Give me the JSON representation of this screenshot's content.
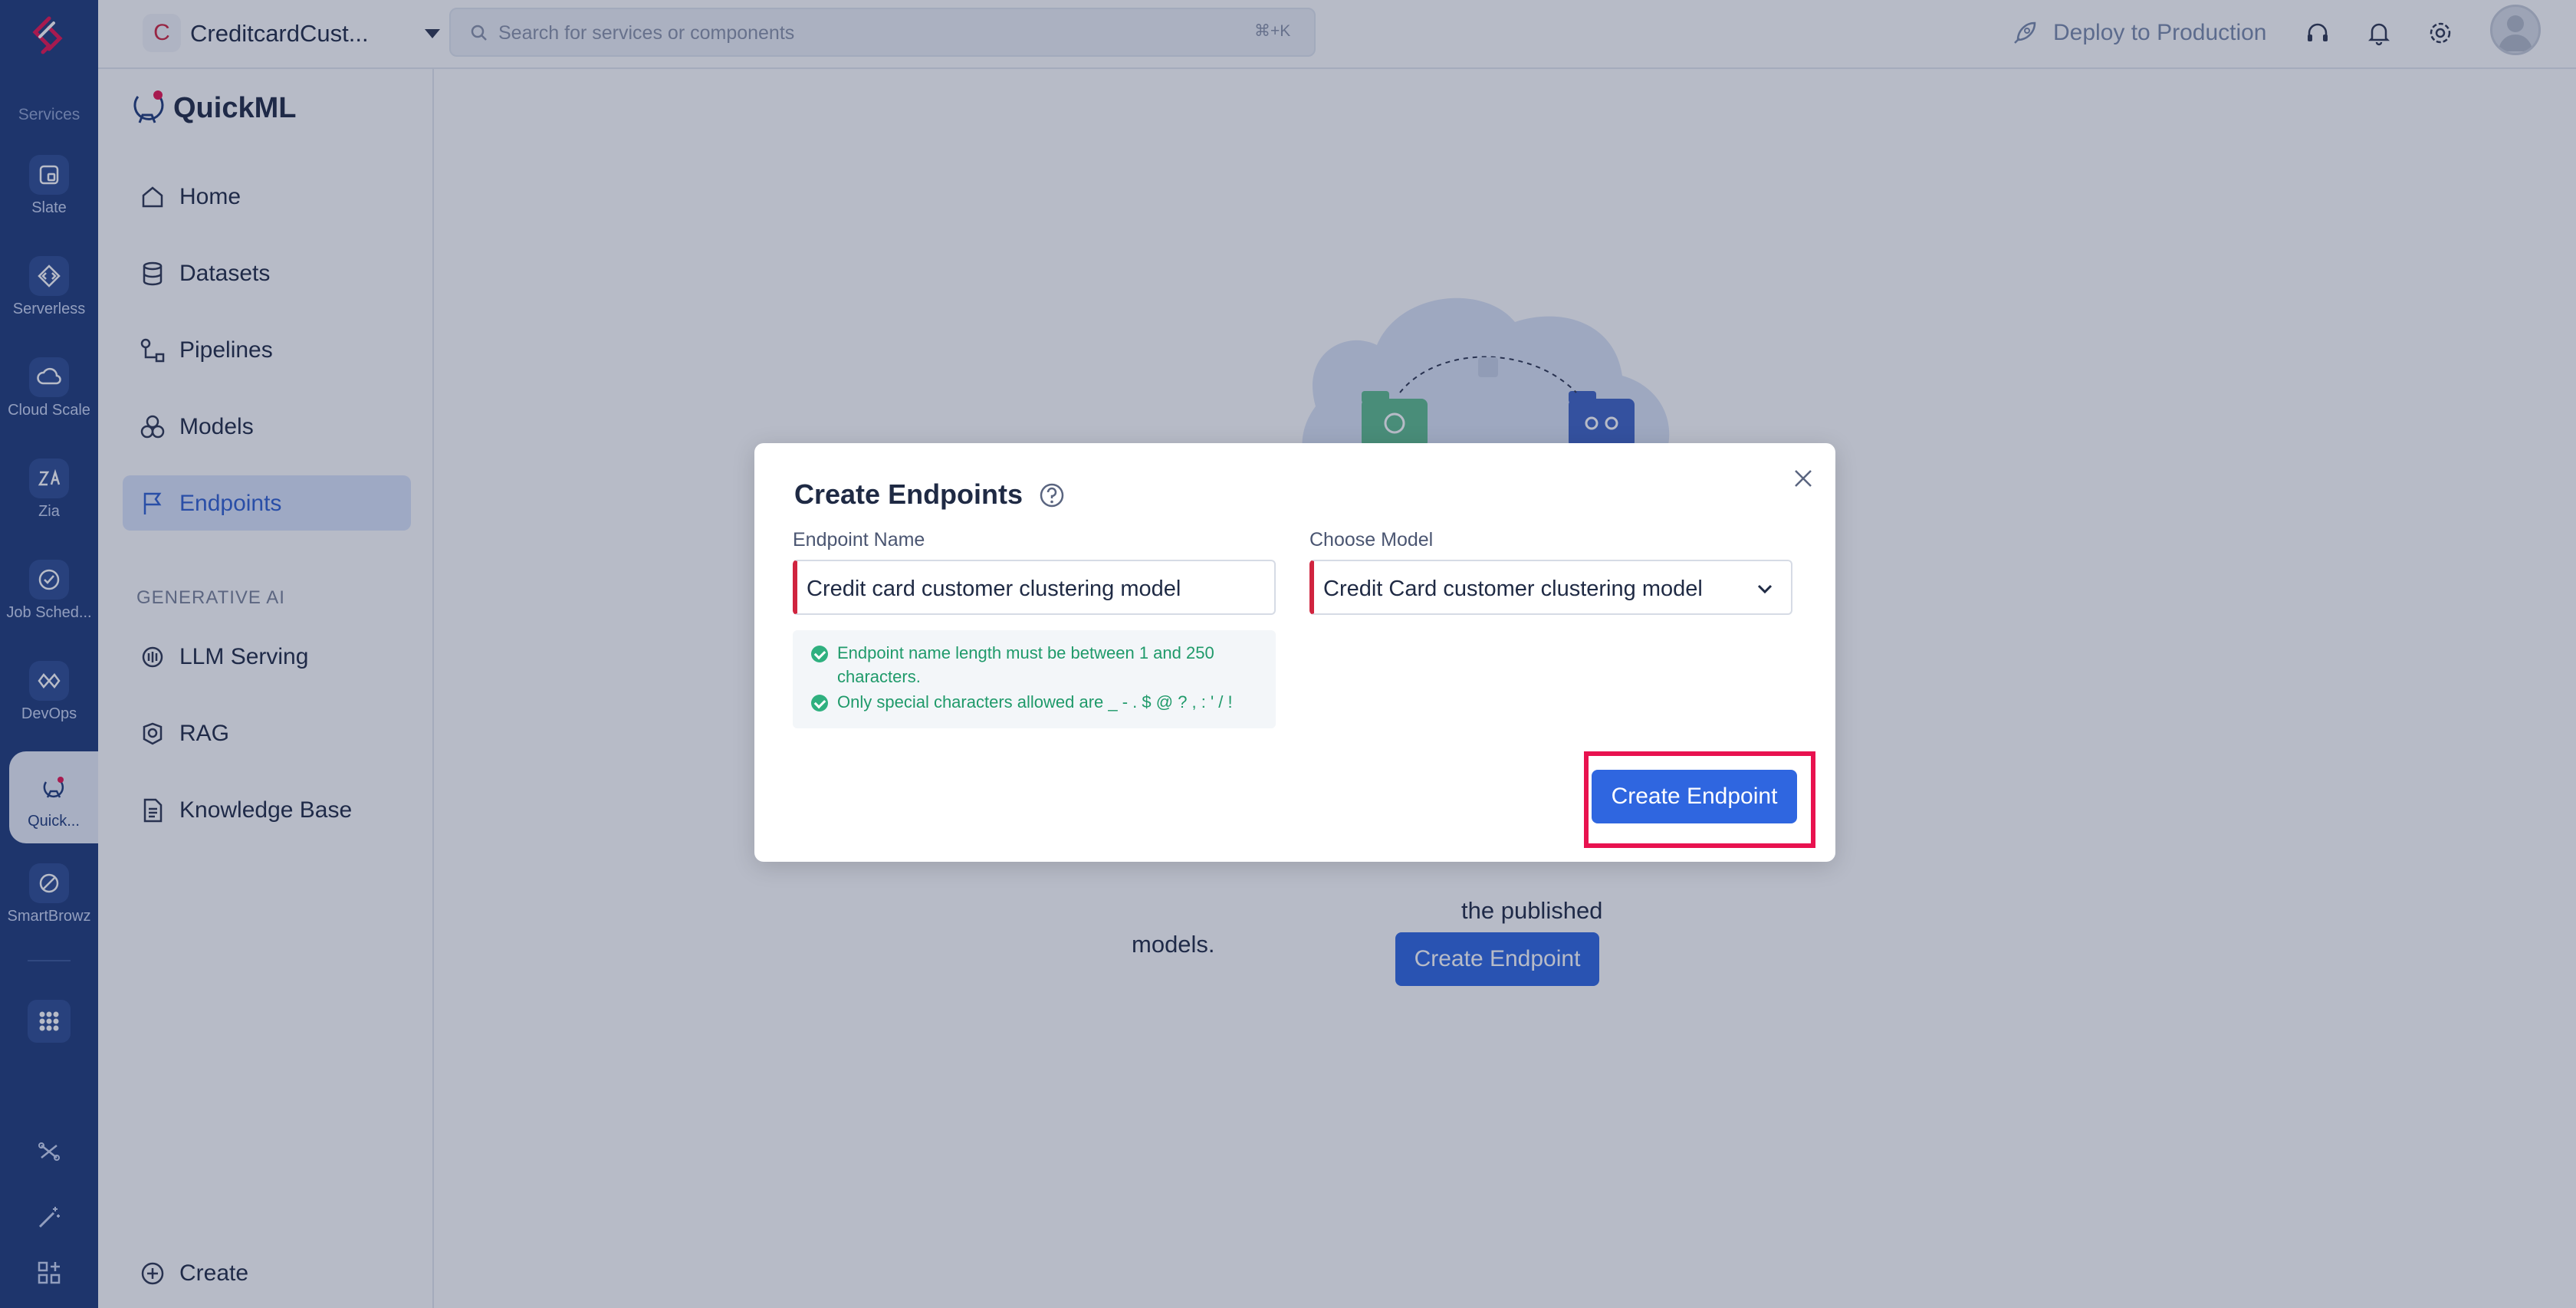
{
  "rail": {
    "section_label": "Services",
    "items": [
      {
        "label": "Slate",
        "icon": "slate-icon"
      },
      {
        "label": "Serverless",
        "icon": "serverless-icon"
      },
      {
        "label": "Cloud Scale",
        "icon": "cloud-scale-icon"
      },
      {
        "label": "Zia",
        "icon": "zia-icon"
      },
      {
        "label": "Job Sched...",
        "icon": "job-scheduling-icon"
      },
      {
        "label": "DevOps",
        "icon": "devops-icon"
      },
      {
        "label": "Quick...",
        "icon": "quickml-icon",
        "active": true
      },
      {
        "label": "SmartBrowz",
        "icon": "smartbrowz-icon"
      }
    ]
  },
  "topbar": {
    "project_initial": "C",
    "project_name": "CreditcardCust...",
    "search_placeholder": "Search for services or components",
    "search_shortcut": "⌘+K",
    "deploy_label": "Deploy to Production"
  },
  "sidebar": {
    "brand": "QuickML",
    "items": [
      {
        "label": "Home"
      },
      {
        "label": "Datasets"
      },
      {
        "label": "Pipelines"
      },
      {
        "label": "Models"
      },
      {
        "label": "Endpoints",
        "active": true
      }
    ],
    "section_generative": "GENERATIVE AI",
    "gen_items": [
      {
        "label": "LLM Serving"
      },
      {
        "label": "RAG"
      },
      {
        "label": "Knowledge Base"
      }
    ],
    "create_label": "Create"
  },
  "main": {
    "empty_text_tail": "the published",
    "empty_text_line2": "models.",
    "empty_button": "Create Endpoint"
  },
  "modal": {
    "title": "Create Endpoints",
    "endpoint_name_label": "Endpoint Name",
    "endpoint_name_value": "Credit card customer clustering model",
    "choose_model_label": "Choose Model",
    "choose_model_value": "Credit Card customer clustering model",
    "hints": [
      "Endpoint name length must be between 1 and 250 characters.",
      "Only special characters allowed are _ - . $ @ ? , : ' / !"
    ],
    "submit_label": "Create Endpoint"
  },
  "colors": {
    "rail_bg": "#1e3a7a",
    "accent": "#2f66e0",
    "required_marker": "#d0243f",
    "highlight": "#e8124f",
    "success": "#1f9a6a"
  }
}
